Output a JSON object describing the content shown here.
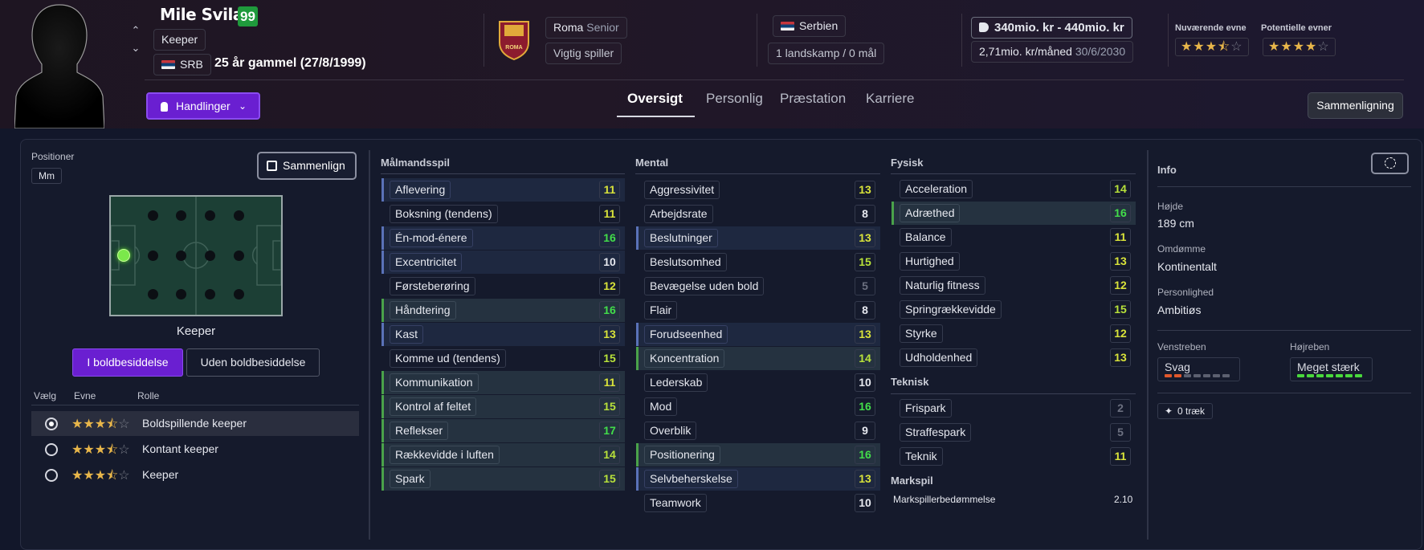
{
  "player": {
    "name": "Mile Svilar",
    "ability": "99",
    "position": "Keeper",
    "nationality_code": "SRB",
    "age_text": "25 år gammel (27/8/1999)"
  },
  "club": {
    "name": "Roma",
    "squad": "Senior",
    "status": "Vigtig spiller",
    "logo_text": "ROMA"
  },
  "nation": {
    "name": "Serbien",
    "caps": "1 landskamp / 0 mål"
  },
  "contract": {
    "value": "340mio. kr - 440mio. kr",
    "wage": "2,71mio. kr/måned",
    "expiry": "30/6/2030"
  },
  "ratings": {
    "current_label": "Nuværende evne",
    "current_stars": 3.5,
    "potential_label": "Potentielle evner",
    "potential_stars": 4
  },
  "actions": {
    "label": "Handlinger"
  },
  "tabs": [
    {
      "label": "Oversigt"
    },
    {
      "label": "Personlig"
    },
    {
      "label": "Præstation"
    },
    {
      "label": "Karriere"
    }
  ],
  "compare_button": "Sammenligning",
  "positions": {
    "title": "Positioner",
    "current": "Mm",
    "compare_btn": "Sammenlign",
    "role_label": "Keeper",
    "seg_on": "I boldbesiddelse",
    "seg_off": "Uden boldbesiddelse",
    "col_headers": {
      "select": "Vælg",
      "ability": "Evne",
      "role": "Rolle"
    },
    "roles": [
      {
        "name": "Boldspillende keeper",
        "stars": 3.5,
        "selected": true
      },
      {
        "name": "Kontant keeper",
        "stars": 3.5,
        "selected": false
      },
      {
        "name": "Keeper",
        "stars": 3.5,
        "selected": false
      }
    ]
  },
  "attributes": {
    "goalkeeping": {
      "title": "Målmandsspil",
      "items": [
        {
          "name": "Aflevering",
          "value": "11",
          "style": "blue"
        },
        {
          "name": "Boksning (tendens)",
          "value": "11",
          "style": ""
        },
        {
          "name": "Én-mod-énere",
          "value": "16",
          "style": "blue"
        },
        {
          "name": "Excentricitet",
          "value": "10",
          "style": "blue"
        },
        {
          "name": "Førsteberøring",
          "value": "12",
          "style": ""
        },
        {
          "name": "Håndtering",
          "value": "16",
          "style": "green"
        },
        {
          "name": "Kast",
          "value": "13",
          "style": "blue"
        },
        {
          "name": "Komme ud (tendens)",
          "value": "15",
          "style": ""
        },
        {
          "name": "Kommunikation",
          "value": "11",
          "style": "green"
        },
        {
          "name": "Kontrol af feltet",
          "value": "15",
          "style": "green"
        },
        {
          "name": "Reflekser",
          "value": "17",
          "style": "green"
        },
        {
          "name": "Rækkevidde i luften",
          "value": "14",
          "style": "green"
        },
        {
          "name": "Spark",
          "value": "15",
          "style": "green"
        }
      ]
    },
    "mental": {
      "title": "Mental",
      "items": [
        {
          "name": "Aggressivitet",
          "value": "13",
          "style": ""
        },
        {
          "name": "Arbejdsrate",
          "value": "8",
          "style": ""
        },
        {
          "name": "Beslutninger",
          "value": "13",
          "style": "blue"
        },
        {
          "name": "Beslutsomhed",
          "value": "15",
          "style": ""
        },
        {
          "name": "Bevægelse uden bold",
          "value": "5",
          "style": ""
        },
        {
          "name": "Flair",
          "value": "8",
          "style": ""
        },
        {
          "name": "Forudseenhed",
          "value": "13",
          "style": "blue"
        },
        {
          "name": "Koncentration",
          "value": "14",
          "style": "green"
        },
        {
          "name": "Lederskab",
          "value": "10",
          "style": ""
        },
        {
          "name": "Mod",
          "value": "16",
          "style": ""
        },
        {
          "name": "Overblik",
          "value": "9",
          "style": ""
        },
        {
          "name": "Positionering",
          "value": "16",
          "style": "green"
        },
        {
          "name": "Selvbeherskelse",
          "value": "13",
          "style": "blue"
        },
        {
          "name": "Teamwork",
          "value": "10",
          "style": ""
        }
      ]
    },
    "physical": {
      "title": "Fysisk",
      "items": [
        {
          "name": "Acceleration",
          "value": "14",
          "style": ""
        },
        {
          "name": "Adræthed",
          "value": "16",
          "style": "green"
        },
        {
          "name": "Balance",
          "value": "11",
          "style": ""
        },
        {
          "name": "Hurtighed",
          "value": "13",
          "style": ""
        },
        {
          "name": "Naturlig fitness",
          "value": "12",
          "style": ""
        },
        {
          "name": "Springrækkevidde",
          "value": "15",
          "style": ""
        },
        {
          "name": "Styrke",
          "value": "12",
          "style": ""
        },
        {
          "name": "Udholdenhed",
          "value": "13",
          "style": ""
        }
      ]
    },
    "technical": {
      "title": "Teknisk",
      "items": [
        {
          "name": "Frispark",
          "value": "2",
          "style": ""
        },
        {
          "name": "Straffespark",
          "value": "5",
          "style": ""
        },
        {
          "name": "Teknik",
          "value": "11",
          "style": ""
        }
      ]
    },
    "outfield": {
      "title": "Markspil",
      "label": "Markspillerbedømmelse",
      "value": "2.10"
    }
  },
  "info": {
    "title": "Info",
    "height_label": "Højde",
    "height": "189 cm",
    "reputation_label": "Omdømme",
    "reputation": "Kontinentalt",
    "personality_label": "Personlighed",
    "personality": "Ambitiøs",
    "left_foot_label": "Venstreben",
    "left_foot": "Svag",
    "left_foot_level": 2,
    "right_foot_label": "Højreben",
    "right_foot": "Meget stærk",
    "right_foot_level": 7,
    "traits": "0 træk"
  },
  "colors": {
    "accent": "#6a1fd1",
    "good": "#42dd4a",
    "star": "#e8b64a"
  }
}
